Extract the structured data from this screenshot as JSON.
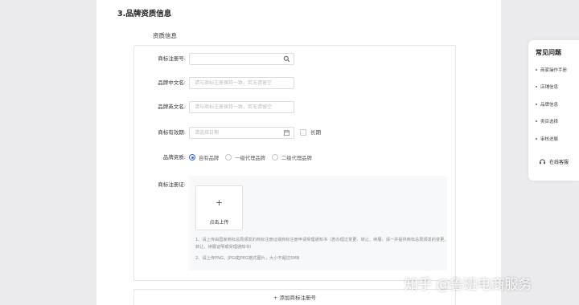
{
  "section": {
    "title": "3.品牌资质信息",
    "sub_title": "资质信息"
  },
  "form": {
    "trademark_no": {
      "label": "商标注册号:",
      "value": ""
    },
    "brand_cn": {
      "label": "品牌中文名:",
      "placeholder": "请与商标注册保持一致，若无请留空"
    },
    "brand_en": {
      "label": "品牌英文名:",
      "placeholder": "请与商标注册保持一致，若无请留空"
    },
    "validity": {
      "label": "商标有效期:",
      "placeholder": "请选择日期",
      "long_term_label": "长期",
      "long_term_checked": false
    },
    "qualification": {
      "label": "品牌资质:",
      "options": [
        "自有品牌",
        "一级代理品牌",
        "二级代理品牌"
      ],
      "selected": "自有品牌"
    },
    "certificate": {
      "label": "商标注册证:",
      "upload_plus": "+",
      "upload_label": "点击上传",
      "tip1": "1、请上传由国家商标总局颁发的商标注册证或商标注册申请受理通知书（若办理过变更、转让、续展，请一并提供商标总局颁发的变更、转让、续展证明或受理通知书）",
      "tip2": "2、请上传PNG、JPG或JPEG格式图片，大小不超过5MB"
    }
  },
  "add_button": {
    "label": "+ 添加商标注册号"
  },
  "faq": {
    "title": "常见问题",
    "items": [
      "商家操作手册",
      "店铺信息",
      "品牌信息",
      "类目选择",
      "审核进展"
    ],
    "customer_service": "在线客服"
  },
  "watermark": "知乎 @鲁班电商服务",
  "colors": {
    "accent": "#3a62f0",
    "page_bg": "#ececee",
    "card_border": "#e6e6e6",
    "upload_bg": "#f7f8fa"
  }
}
